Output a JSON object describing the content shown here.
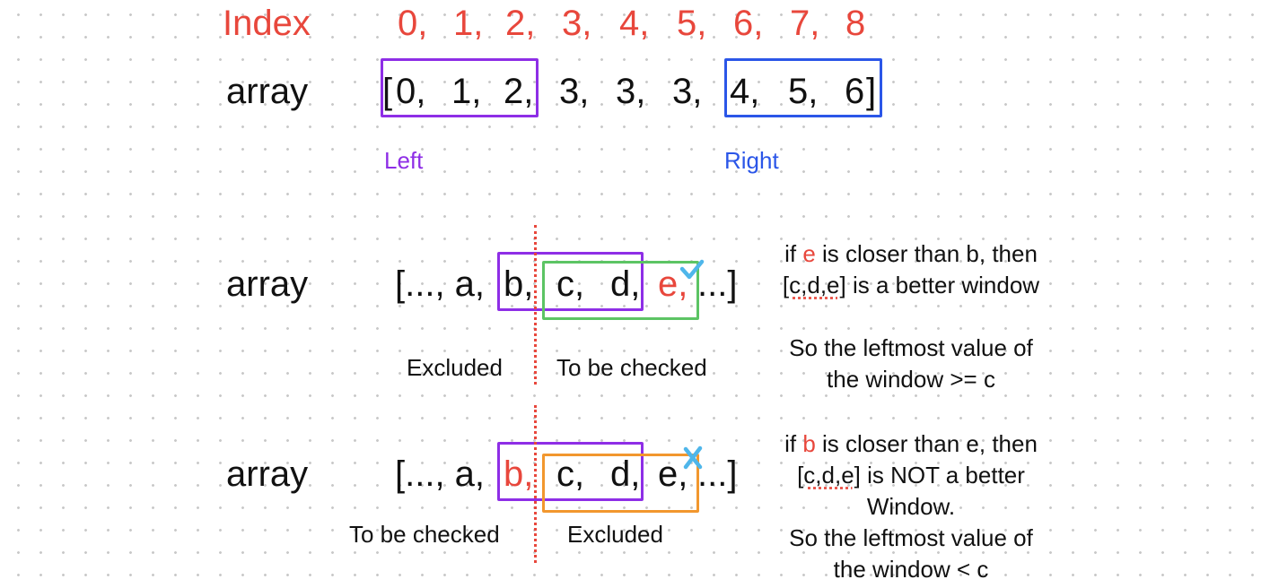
{
  "index_row": {
    "label": "Index",
    "values": [
      "0,",
      "1,",
      "2,",
      "3,",
      "4,",
      "5,",
      "6,",
      "7,",
      "8"
    ]
  },
  "array_row": {
    "label": "array",
    "bracket_open": "[",
    "values": [
      "0,",
      "1,",
      "2,",
      "3,",
      "3,",
      "3,",
      "4,",
      "5,",
      "6"
    ],
    "bracket_close": "]",
    "left_label": "Left",
    "right_label": "Right"
  },
  "case1": {
    "label": "array",
    "tokens": [
      "[..., a,",
      "b,",
      "c,",
      "d,",
      "e,",
      "...]"
    ],
    "excluded_label": "Excluded",
    "checked_label": "To be checked",
    "note_line1_pre": "if ",
    "note_line1_highlight": "e",
    "note_line1_post": " is closer than b, then",
    "note_line2_window": "[c,d,e]",
    "note_line2_post": " is a better window",
    "note_line3": "So the leftmost value of",
    "note_line4": "the window >= c"
  },
  "case2": {
    "label": "array",
    "tokens": [
      "[..., a,",
      "b,",
      "c,",
      "d,",
      "e,",
      "...]"
    ],
    "checked_label": "To be checked",
    "excluded_label": "Excluded",
    "note_line1_pre": "if ",
    "note_line1_highlight": "b",
    "note_line1_post": " is closer than e, then",
    "note_line2_window": "[c,d,e]",
    "note_line2_post": " is NOT a better",
    "note_line3": "Window.",
    "note_line4": "So the leftmost value of",
    "note_line5": "the window < c"
  },
  "icons": {
    "case1": "check-icon",
    "case2": "cross-icon"
  },
  "colors": {
    "red": "#e8473c",
    "purple": "#8e2ee6",
    "blue": "#2b56e8",
    "green": "#5cc464",
    "orange": "#f2972e",
    "mark": "#4fb6ea"
  }
}
